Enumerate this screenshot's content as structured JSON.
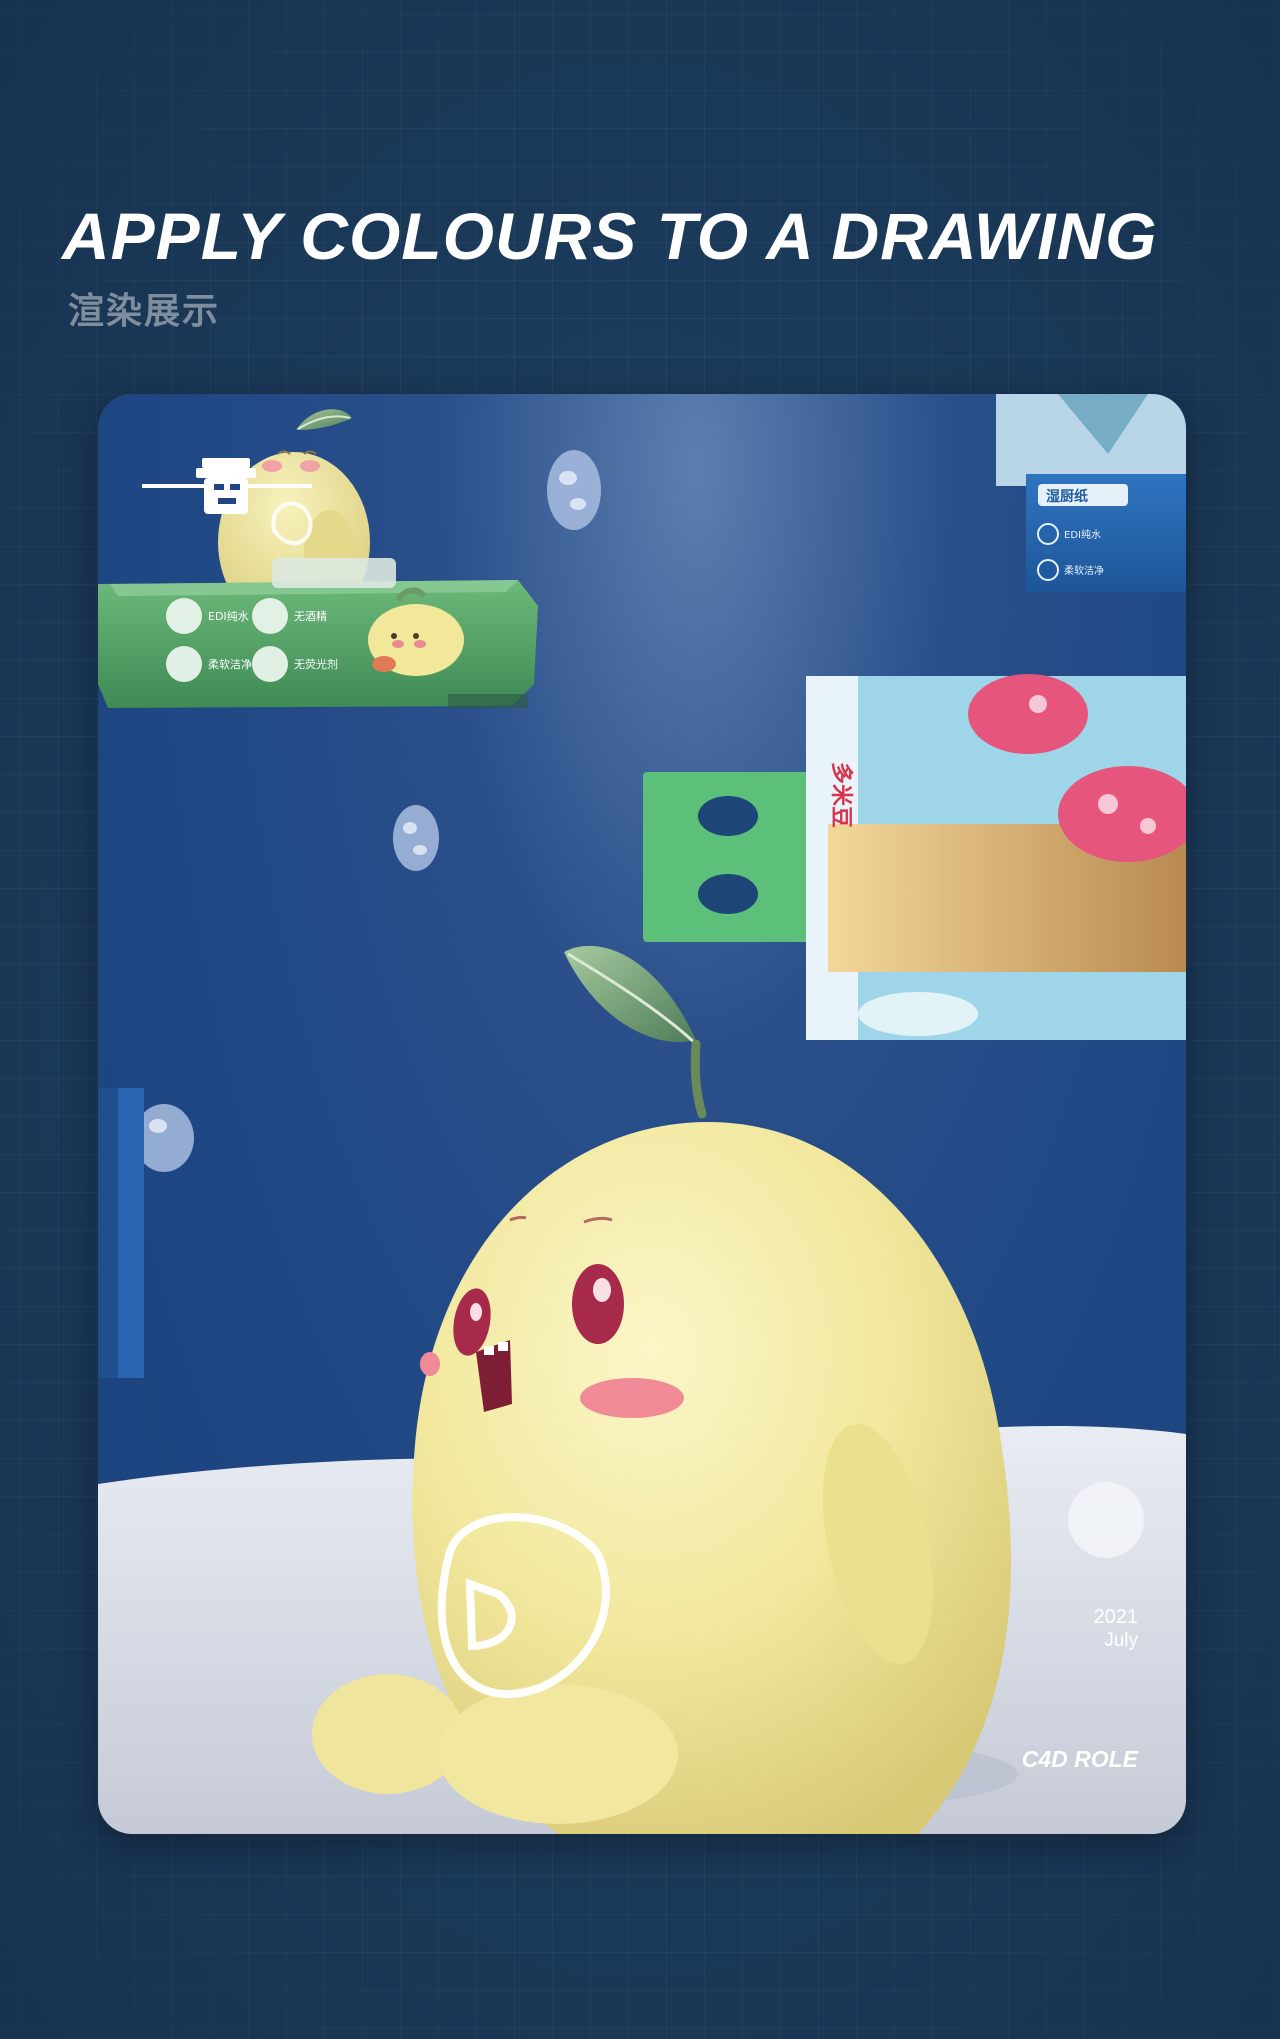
{
  "header": {
    "title": "APPLY COLOURS TO A DRAWING",
    "subtitle": "渲染展示"
  },
  "card": {
    "date_year": "2021",
    "date_month": "July",
    "role_label": "C4D ROLE"
  },
  "green_pack": {
    "feature_1": "EDI纯水",
    "feature_2": "无酒精",
    "feature_3": "柔软洁净",
    "feature_4": "无荧光剂"
  },
  "blue_pack": {
    "brand": "湿厨纸",
    "feature_1": "EDI纯水",
    "feature_2": "柔软洁净"
  },
  "tissue_pack": {
    "brand": "多米豆"
  },
  "colors": {
    "page_background": "#1c3b5c",
    "scene_background": "#1e4784",
    "mascot_yellow": "#f4eca0",
    "leaf_green": "#6f9a72",
    "cheek_pink": "#ef8a96",
    "wipes_green": "#56a86a"
  }
}
